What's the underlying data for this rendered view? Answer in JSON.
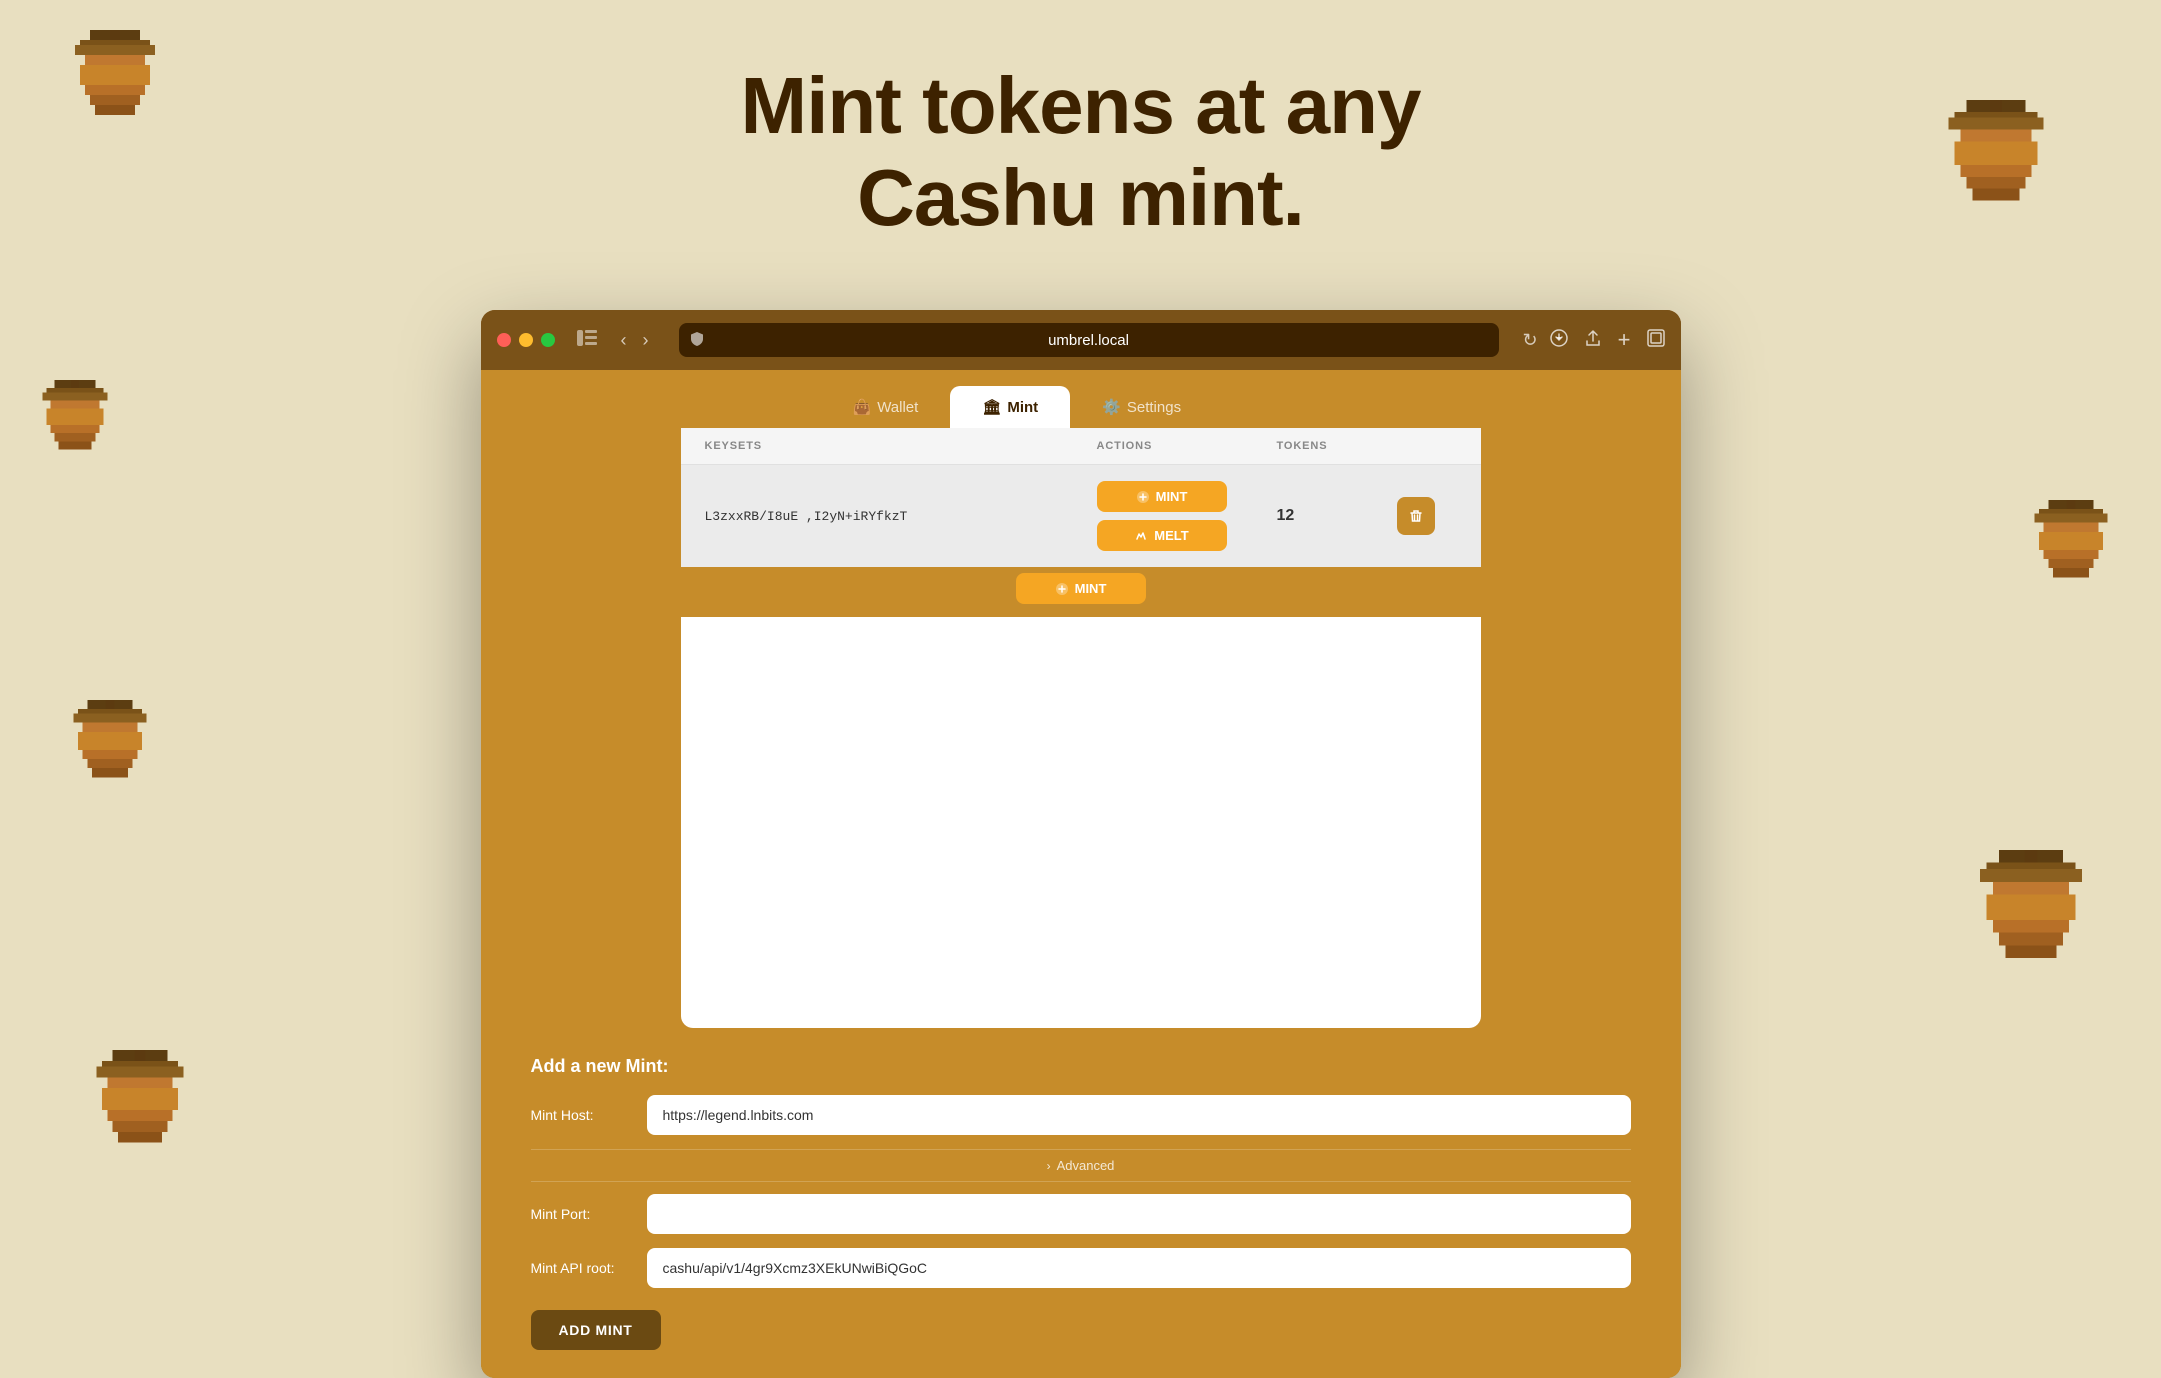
{
  "page": {
    "background_color": "#e8dfc0",
    "headline_line1": "Mint tokens at any",
    "headline_line2": "Cashu mint."
  },
  "browser": {
    "url": "umbrel.local",
    "traffic_lights": {
      "red": "#ff5f57",
      "yellow": "#febc2e",
      "green": "#28c840"
    }
  },
  "tabs": [
    {
      "id": "wallet",
      "label": "Wallet",
      "icon": "💼",
      "active": false
    },
    {
      "id": "mint",
      "label": "Mint",
      "icon": "🏛",
      "active": true
    },
    {
      "id": "settings",
      "label": "Settings",
      "icon": "⚙️",
      "active": false
    }
  ],
  "table": {
    "columns": [
      {
        "key": "keysets",
        "label": "KEYSETS"
      },
      {
        "key": "actions",
        "label": "ACTIONS"
      },
      {
        "key": "tokens",
        "label": "TOKENS"
      }
    ],
    "rows": [
      {
        "keyset_id": "L3zxxRB/I8uE ,I2yN+iRYfkzT",
        "tokens": "12",
        "mint_label": "MINT",
        "melt_label": "MELT"
      }
    ]
  },
  "add_mint": {
    "title": "Add a new Mint:",
    "host_label": "Mint Host:",
    "host_placeholder": "https://legend.lnbits.com",
    "host_value": "https://legend.lnbits.com",
    "advanced_label": "Advanced",
    "port_label": "Mint Port:",
    "port_value": "",
    "api_root_label": "Mint API root:",
    "api_root_value": "cashu/api/v1/4gr9Xcmz3XEkUNwiBiQGoC",
    "add_button_label": "ADD MINT"
  }
}
